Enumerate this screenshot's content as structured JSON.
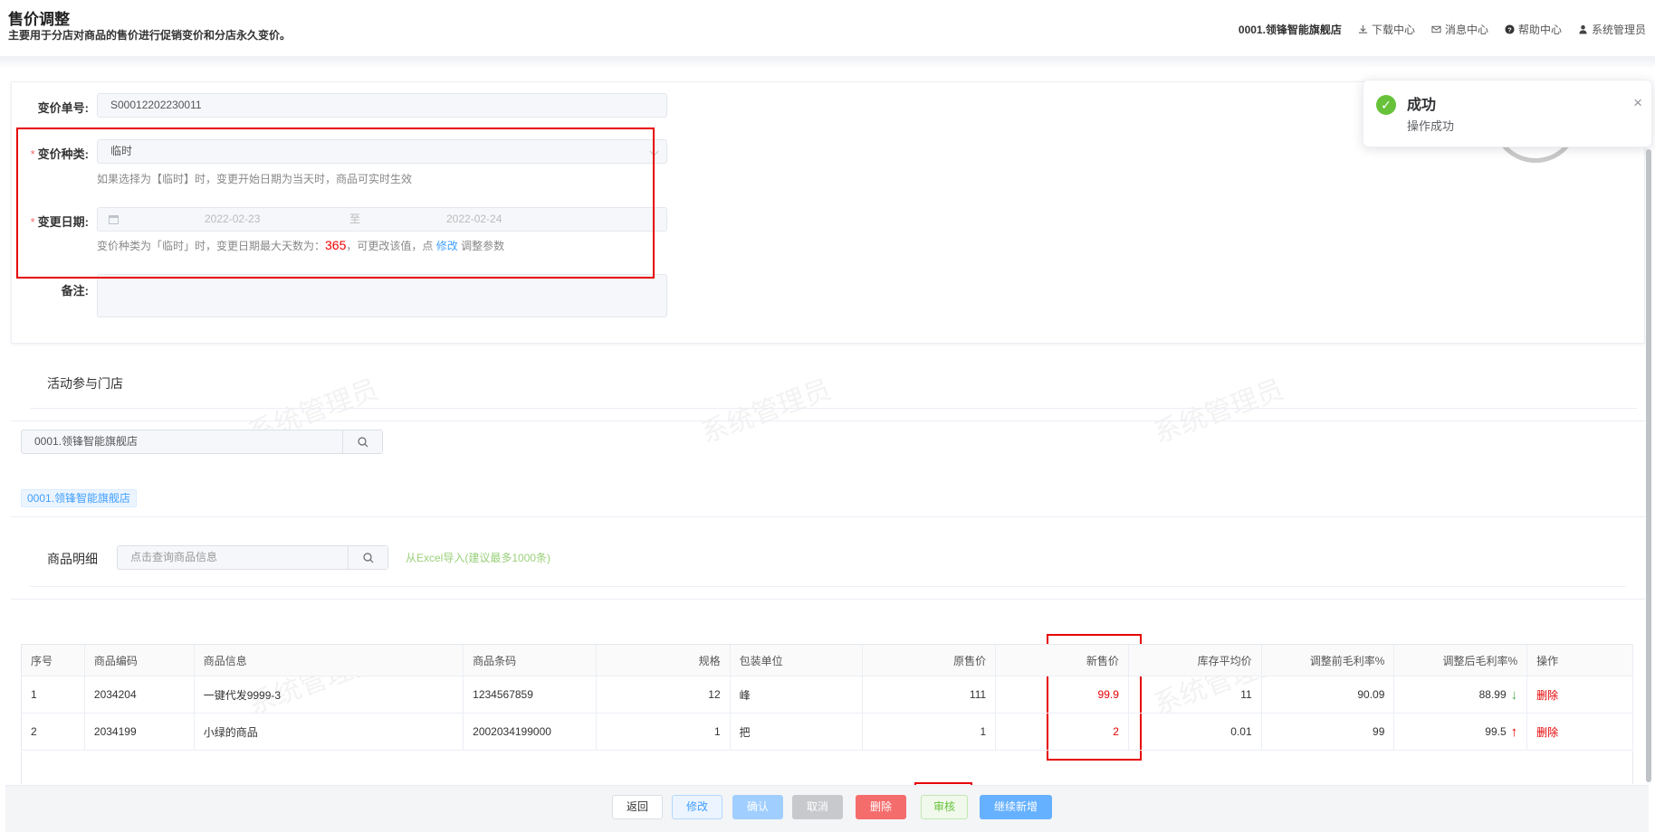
{
  "header": {
    "title": "售价调整",
    "subtitle": "主要用于分店对商品的售价进行促销变价和分店永久变价。",
    "store": "0001.领锋智能旗舰店",
    "download_center": "下载中心",
    "message_center": "消息中心",
    "help_center": "帮助中心",
    "user": "系统管理员"
  },
  "form": {
    "order_no_label": "变价单号:",
    "order_no_value": "S00012202230011",
    "type_label": "变价种类:",
    "type_value": "临时",
    "type_hint": "如果选择为【临时】时，变更开始日期为当天时，商品可实时生效",
    "date_label": "变更日期:",
    "date_from": "2022-02-23",
    "date_sep": "至",
    "date_to": "2022-02-24",
    "date_hint_pre": "变价种类为「临时」时，变更日期最大天数为：",
    "date_hint_num": "365",
    "date_hint_mid": "，可更改该值，点",
    "date_hint_link": "修改",
    "date_hint_post": "调整参数",
    "remark_label": "备注:"
  },
  "stores": {
    "section_title": "活动参与门店",
    "search_value": "0001.领锋智能旗舰店",
    "tag": "0001.领锋智能旗舰店"
  },
  "goods": {
    "section_title": "商品明细",
    "search_placeholder": "点击查询商品信息",
    "excel_link": "从Excel导入(建议最多1000条)"
  },
  "table": {
    "headers": [
      "序号",
      "商品编码",
      "商品信息",
      "商品条码",
      "规格",
      "包装单位",
      "原售价",
      "新售价",
      "库存平均价",
      "调整前毛利率%",
      "调整后毛利率%",
      "操作"
    ],
    "rows": [
      [
        "1",
        "2034204",
        "一键代发9999-3",
        "1234567859",
        "12",
        "峰",
        "111",
        "99.9",
        "11",
        "90.09",
        "88.99",
        "删除"
      ],
      [
        "2",
        "2034199",
        "小绿的商品",
        "2002034199000",
        "1",
        "把",
        "1",
        "2",
        "0.01",
        "99",
        "99.5",
        "删除"
      ]
    ]
  },
  "footer": {
    "back": "返回",
    "edit": "修改",
    "confirm": "确认",
    "cancel": "取消",
    "delete": "删除",
    "audit": "审核",
    "continue_new": "继续新增"
  },
  "toast": {
    "title": "成功",
    "message": "操作成功"
  },
  "watermark": "系统管理员",
  "colors": {
    "required": "#f56c6c",
    "highlight_box": "#e60000",
    "link": "#409eff",
    "success": "#67c23a"
  }
}
